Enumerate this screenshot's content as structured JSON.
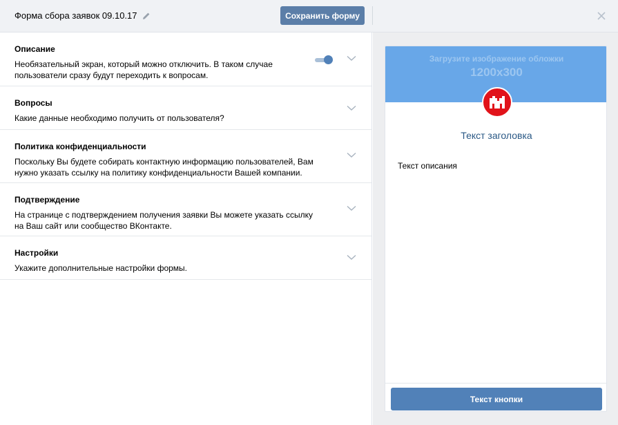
{
  "header": {
    "title": "Форма сбора заявок 09.10.17",
    "save_label": "Сохранить форму"
  },
  "sections": [
    {
      "title": "Описание",
      "desc": "Необязательный экран, который можно отключить. В таком случае пользователи сразу будут переходить к вопросам.",
      "toggle_on": true
    },
    {
      "title": "Вопросы",
      "desc": "Какие данные необходимо получить от пользователя?"
    },
    {
      "title": "Политика конфиденциальности",
      "desc": "Поскольку Вы будете собирать контактную информацию пользователей, Вам нужно указать ссылку на политику конфиденциальности Вашей компании."
    },
    {
      "title": "Подтверждение",
      "desc": "На странице с подтверждением получения заявки Вы можете указать ссылку на Ваш сайт или сообщество ВКонтакте."
    },
    {
      "title": "Настройки",
      "desc": "Укажите дополнительные настройки формы."
    }
  ],
  "preview": {
    "cover_line1": "Загрузите изображение обложки",
    "cover_line2": "1200x300",
    "title": "Текст заголовка",
    "desc": "Текст описания",
    "button_label": "Текст кнопки"
  },
  "icons": {
    "edit": "pencil-icon",
    "close": "close-icon",
    "expand": "chevron-down-icon",
    "logo": "brand-logo"
  },
  "colors": {
    "accent": "#5181b8",
    "cover": "#68a7e8",
    "logo": "#e1131a",
    "title_link": "#2a5885"
  }
}
